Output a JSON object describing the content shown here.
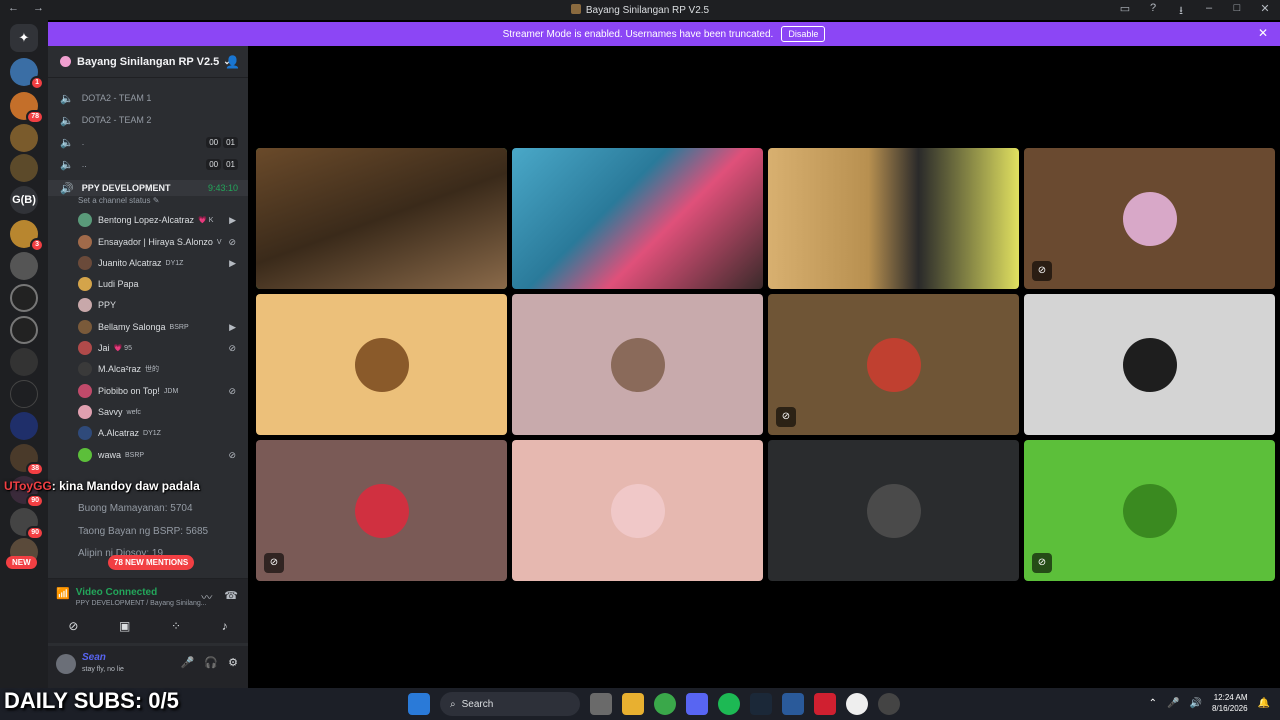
{
  "window": {
    "back": "←",
    "forward": "→",
    "title": "Bayang Sinilangan RP V2.5"
  },
  "banner": {
    "text": "Streamer Mode is enabled. Usernames have been truncated.",
    "disable_label": "Disable"
  },
  "guild_rail": {
    "badges": [
      "1",
      "78",
      "3",
      "38",
      "90",
      "90"
    ],
    "gb_label": "G(B)",
    "new_label": "NEW"
  },
  "server": {
    "name": "Bayang Sinilangan RP V2.5"
  },
  "channels": [
    {
      "name": "DOTA2 - TEAM 1"
    },
    {
      "name": "DOTA2 - TEAM 2"
    },
    {
      "name": ".",
      "count_a": "00",
      "count_b": "01"
    },
    {
      "name": "..",
      "count_a": "00",
      "count_b": "01"
    }
  ],
  "active_channel": {
    "name": "PPY DEVELOPMENT",
    "timer": "9:43:10",
    "status_placeholder": "Set a channel status"
  },
  "members": [
    {
      "name": "Bentong Lopez-Alcatraz",
      "tag": "💗 K"
    },
    {
      "name": "Ensayador | Hiraya S.Alonzo",
      "tag": "V"
    },
    {
      "name": "Juanito Alcatraz",
      "tag": "DY1Z"
    },
    {
      "name": "Ludi Papa",
      "tag": ""
    },
    {
      "name": "PPY",
      "tag": ""
    },
    {
      "name": "Bellamy Salonga",
      "tag": "BSRP"
    },
    {
      "name": "Jai",
      "tag": "💗 95"
    },
    {
      "name": "M.Alca²raz",
      "tag": "世的"
    },
    {
      "name": "Piobibo on Top!",
      "tag": "JDM"
    },
    {
      "name": "Savvy",
      "tag": "wefc"
    },
    {
      "name": "A.Alcatraz",
      "tag": "DY1Z"
    },
    {
      "name": "wawa",
      "tag": "BSRP"
    }
  ],
  "chat_overlay": {
    "user": "UToyGG",
    "message": ": kina Mandoy daw padala"
  },
  "lower_channels": [
    "Buong Mamayanan: 5704",
    "Taong Bayan ng BSRP: 5685",
    "Alipin ni Diosoy: 19"
  ],
  "mentions_label": "78 NEW MENTIONS",
  "voice": {
    "status": "Video Connected",
    "location": "PPY DEVELOPMENT / Bayang Sinilang..."
  },
  "user": {
    "name": "Sean",
    "status": "stay fly, no lie"
  },
  "stream_overlay": {
    "subs": "DAILY SUBS: 0/5"
  },
  "taskbar": {
    "search": "Search",
    "time": "12:24 AM",
    "date": "8/16/2026"
  },
  "colors": {
    "accent": "#8c46f5",
    "speaking": "#23a55a",
    "mention": "#f23f43"
  }
}
